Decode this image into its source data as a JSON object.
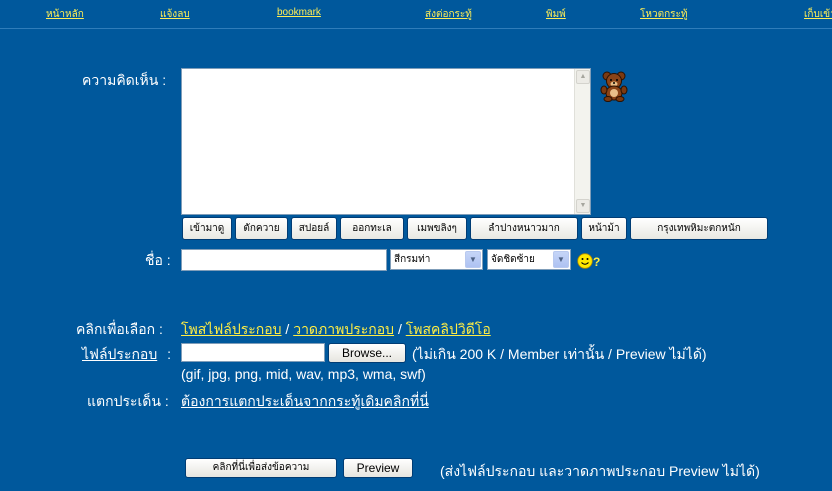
{
  "nav": [
    {
      "label": "หน้าหลัก"
    },
    {
      "label": "แจ้งลบ"
    },
    {
      "label": "bookmark"
    },
    {
      "label": "ส่งต่อกระทู้"
    },
    {
      "label": "พิมพ์"
    },
    {
      "label": "โหวตกระทู้"
    },
    {
      "label": "เก็บเข้า"
    }
  ],
  "form": {
    "comment_label": "ความคิดเห็น :",
    "comment_value": "",
    "emoticon_buttons": [
      {
        "label": "เข้ามาดู"
      },
      {
        "label": "ตักควาย"
      },
      {
        "label": "สปอยล์"
      },
      {
        "label": "ออกทะเล"
      },
      {
        "label": "เมพขลิงๆ"
      },
      {
        "label": "ลำปางหนาวมาก"
      },
      {
        "label": "หน้าม้า"
      },
      {
        "label": "กรุงเทพหิมะตกหนัก"
      }
    ],
    "name_label": "ชื่อ :",
    "name_value": "",
    "color_select": "สีกรมท่า",
    "align_select": "จัดชิดซ้าย",
    "question_mark": "?",
    "attach_label": "คลิกเพื่อเลือก :",
    "attach_link_file": "โพสไฟล์ประกอบ",
    "attach_link_draw": "วาดภาพประกอบ",
    "attach_link_video": "โพสคลิปวิดีโอ",
    "separator": "/",
    "file_label": "ไฟล์ประกอบ",
    "file_colon": ":",
    "browse_label": "Browse...",
    "file_note": "(ไม่เกิน 200 K / Member เท่านั้น / Preview ไม่ได้)",
    "file_types": "(gif, jpg, png, mid, wav, mp3, wma, swf)",
    "branch_label": "แตกประเด็น :",
    "branch_link": "ต้องการแตกประเด็นจากกระทู้เดิมคลิกที่นี่",
    "submit_label": "คลิกที่นี่เพื่อส่งข้อความ",
    "preview_label": "Preview",
    "preview_note": "(ส่งไฟล์ประกอบ และวาดภาพประกอบ Preview ไม่ได้)"
  }
}
